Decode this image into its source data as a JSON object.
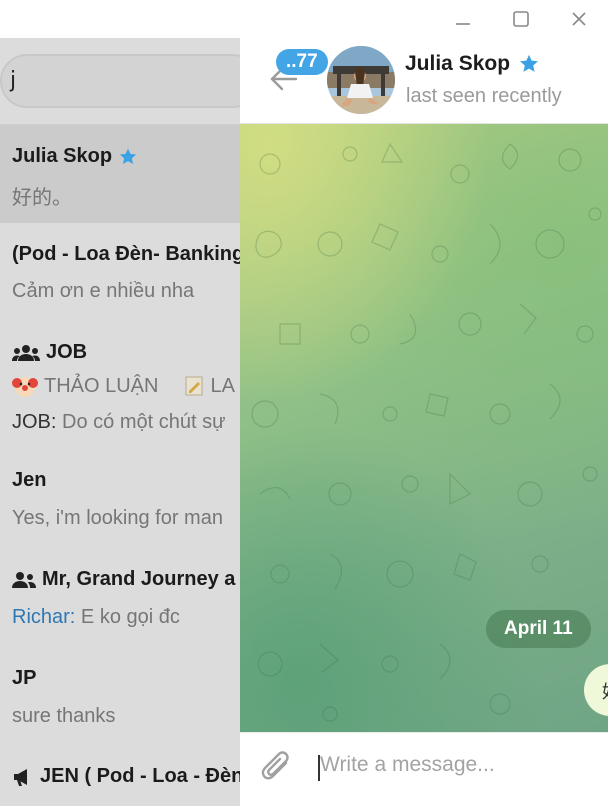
{
  "window": {
    "controls": [
      "minimize",
      "maximize",
      "close"
    ]
  },
  "search": {
    "value": "j"
  },
  "chats": [
    {
      "name": "Julia Skop",
      "verified": true,
      "preview": "好的。",
      "active": true
    },
    {
      "name": "(Pod - Loa Đèn- Banking",
      "preview": "Cảm ơn e nhiều nha"
    },
    {
      "name": "JOB",
      "is_group": true,
      "tags": [
        "THẢO LUẬN",
        "LA"
      ],
      "sender": "JOB:",
      "preview": " Do có một chút sự"
    },
    {
      "name": "Jen",
      "preview": "Yes, i'm looking for man"
    },
    {
      "name": "Mr, Grand Journey a",
      "is_group": true,
      "sender": "Richar:",
      "preview": " E ko gọi đc"
    },
    {
      "name": "JP",
      "preview": "sure thanks"
    },
    {
      "name": "JEN ( Pod - Loa - Đèn",
      "is_channel": true
    }
  ],
  "header": {
    "unread": "..77",
    "name": "Julia Skop",
    "verified": true,
    "status": "last seen recently"
  },
  "messages": {
    "date_pill": "April 11",
    "partial_bubble": "好"
  },
  "composer": {
    "placeholder": "Write a message..."
  },
  "colors": {
    "accent": "#43a4e6",
    "star": "#3aa2e4",
    "sender": "#2f78b4"
  }
}
